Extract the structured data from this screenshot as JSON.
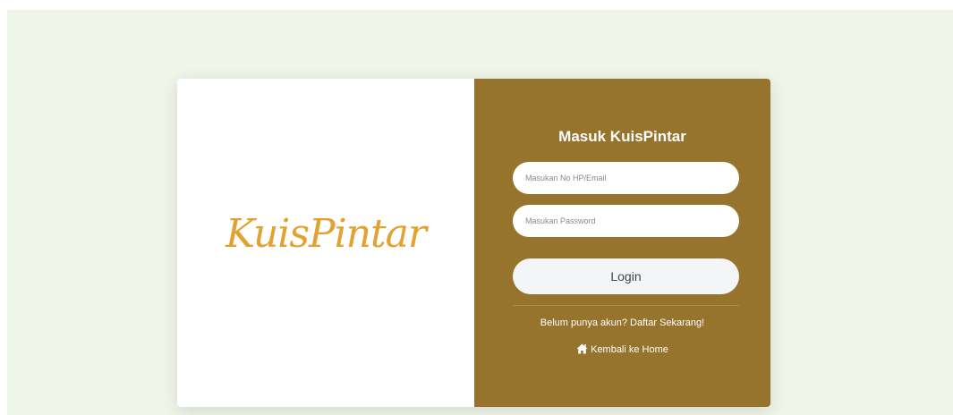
{
  "brand": {
    "logo_text": "KuisPintar",
    "logo_color": "#e3a22f"
  },
  "login_form": {
    "title": "Masuk KuisPintar",
    "email_placeholder": "Masukan No HP/Email",
    "password_placeholder": "Masukan Password",
    "login_label": "Login",
    "register_text": "Belum punya akun? Daftar Sekarang!",
    "home_text": "Kembali ke Home",
    "home_icon": "home-icon",
    "panel_color": "#97742d"
  },
  "page": {
    "background_color": "#eff5e8"
  }
}
